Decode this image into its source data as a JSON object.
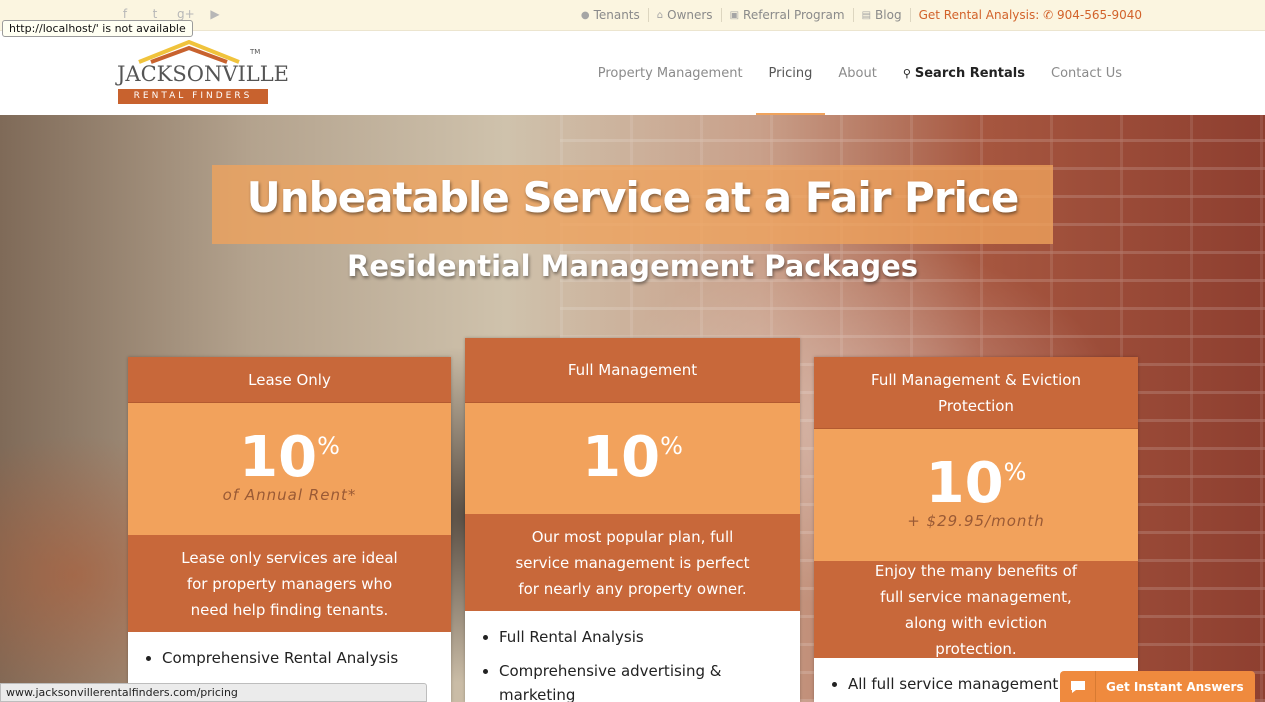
{
  "tooltip": "http://localhost/' is not available",
  "status_url": "www.jacksonvillerentalfinders.com/pricing",
  "social": [
    {
      "icon": "facebook-icon",
      "glyph": "f"
    },
    {
      "icon": "twitter-icon",
      "glyph": "t"
    },
    {
      "icon": "google-plus-icon",
      "glyph": "g+"
    },
    {
      "icon": "youtube-icon",
      "glyph": "▶"
    }
  ],
  "utility": {
    "tenants": "Tenants",
    "owners": "Owners",
    "referral": "Referral Program",
    "blog": "Blog",
    "cta_label": "Get Rental Analysis:",
    "cta_phone": "904-565-9040"
  },
  "logo": {
    "name": "JACKSONVILLE",
    "sub": "RENTAL FINDERS",
    "tm": "TM"
  },
  "nav": {
    "items": [
      "Property Management",
      "Pricing",
      "About",
      "Search Rentals",
      "Contact Us"
    ],
    "active": "Pricing"
  },
  "hero": {
    "title": "Unbeatable Service at a Fair Price",
    "subtitle": "Residential Management Packages"
  },
  "cards": [
    {
      "title": "Lease Only",
      "value": "10",
      "unit": "%",
      "note": "of Annual Rent*",
      "desc": "Lease only services are ideal for property managers who need help finding tenants.",
      "features": [
        "Comprehensive Rental Analysis"
      ]
    },
    {
      "title": "Full Management",
      "value": "10",
      "unit": "%",
      "note": "",
      "desc": "Our most popular plan, full service management is perfect for nearly any property owner.",
      "features": [
        "Full Rental Analysis",
        "Comprehensive advertising & marketing"
      ]
    },
    {
      "title": "Full Management & Eviction Protection",
      "value": "10",
      "unit": "%",
      "note": "+ $29.95/month",
      "desc": "Enjoy the many benefits of full service management, along with eviction protection.",
      "features": [
        "All full service management features"
      ]
    }
  ],
  "chat": {
    "label": "Get Instant Answers"
  },
  "colors": {
    "accent_dark": "#c8683a",
    "accent_light": "#f2a25c",
    "cta": "#d2622a"
  }
}
